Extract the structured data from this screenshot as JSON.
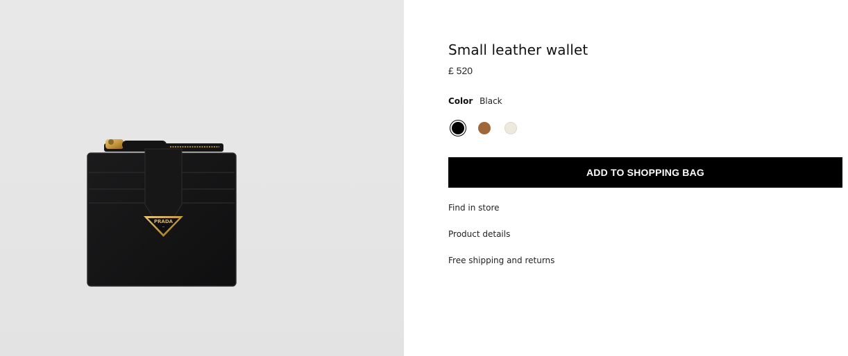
{
  "product": {
    "title": "Small leather wallet",
    "price": "£ 520",
    "image_alt": "Black leather wallet with gold triangle logo",
    "logo_text": "PRADA"
  },
  "color": {
    "label": "Color",
    "selected": "Black",
    "swatches": [
      {
        "name": "Black",
        "hex": "#000000",
        "selected": true
      },
      {
        "name": "Cognac",
        "hex": "#a0683a",
        "selected": false
      },
      {
        "name": "Ivory",
        "hex": "#ede9dc",
        "selected": false
      }
    ]
  },
  "actions": {
    "add_to_bag": "ADD TO SHOPPING BAG"
  },
  "links": {
    "find_in_store": "Find in store",
    "product_details": "Product details",
    "shipping": "Free shipping and returns"
  },
  "colors": {
    "button_bg": "#000000",
    "image_bg": "#e6e6e6"
  }
}
